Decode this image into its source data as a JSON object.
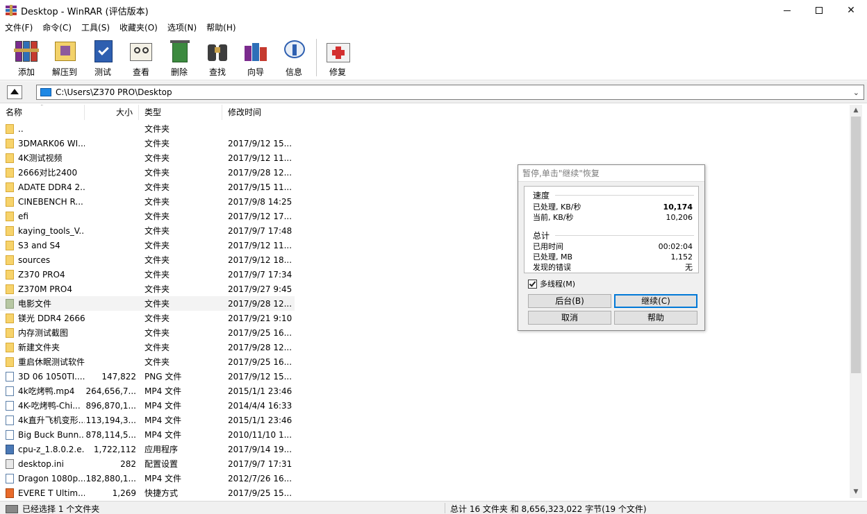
{
  "window": {
    "title": "Desktop - WinRAR (评估版本)",
    "minimize": "—",
    "maximize": "☐",
    "close": "✕"
  },
  "menu": [
    "文件(F)",
    "命令(C)",
    "工具(S)",
    "收藏夹(O)",
    "选项(N)",
    "帮助(H)"
  ],
  "toolbar": {
    "add": "添加",
    "extract": "解压到",
    "test": "测试",
    "view": "查看",
    "delete": "删除",
    "find": "查找",
    "wizard": "向导",
    "info": "信息",
    "repair": "修复"
  },
  "address": {
    "path": "C:\\Users\\Z370 PRO\\Desktop"
  },
  "columns": {
    "name": "名称",
    "size": "大小",
    "type": "类型",
    "modified": "修改时间"
  },
  "files": [
    {
      "name": "..",
      "size": "",
      "type": "文件夹",
      "modified": "",
      "icon": "folder"
    },
    {
      "name": "3DMARK06 WI...",
      "size": "",
      "type": "文件夹",
      "modified": "2017/9/12 15...",
      "icon": "folder"
    },
    {
      "name": "4K测试视频",
      "size": "",
      "type": "文件夹",
      "modified": "2017/9/12 11...",
      "icon": "folder"
    },
    {
      "name": "2666对比2400",
      "size": "",
      "type": "文件夹",
      "modified": "2017/9/28 12...",
      "icon": "folder"
    },
    {
      "name": "ADATE DDR4 2...",
      "size": "",
      "type": "文件夹",
      "modified": "2017/9/15 11...",
      "icon": "folder"
    },
    {
      "name": "CINEBENCH R...",
      "size": "",
      "type": "文件夹",
      "modified": "2017/9/8 14:25",
      "icon": "folder"
    },
    {
      "name": "efi",
      "size": "",
      "type": "文件夹",
      "modified": "2017/9/12 17...",
      "icon": "folder"
    },
    {
      "name": "kaying_tools_V...",
      "size": "",
      "type": "文件夹",
      "modified": "2017/9/7 17:48",
      "icon": "folder"
    },
    {
      "name": "S3 and S4",
      "size": "",
      "type": "文件夹",
      "modified": "2017/9/12 11...",
      "icon": "folder"
    },
    {
      "name": "sources",
      "size": "",
      "type": "文件夹",
      "modified": "2017/9/12 18...",
      "icon": "folder"
    },
    {
      "name": "Z370 PRO4",
      "size": "",
      "type": "文件夹",
      "modified": "2017/9/7 17:34",
      "icon": "folder"
    },
    {
      "name": "Z370M PRO4",
      "size": "",
      "type": "文件夹",
      "modified": "2017/9/27 9:45",
      "icon": "folder"
    },
    {
      "name": "电影文件",
      "size": "",
      "type": "文件夹",
      "modified": "2017/9/28 12...",
      "icon": "folder-g",
      "highlight": true
    },
    {
      "name": "镁光 DDR4 2666",
      "size": "",
      "type": "文件夹",
      "modified": "2017/9/21 9:10",
      "icon": "folder"
    },
    {
      "name": "内存测试截图",
      "size": "",
      "type": "文件夹",
      "modified": "2017/9/25 16...",
      "icon": "folder"
    },
    {
      "name": "新建文件夹",
      "size": "",
      "type": "文件夹",
      "modified": "2017/9/28 12...",
      "icon": "folder"
    },
    {
      "name": "重启休眠测试软件",
      "size": "",
      "type": "文件夹",
      "modified": "2017/9/25 16...",
      "icon": "folder"
    },
    {
      "name": "3D 06  1050TI....",
      "size": "147,822",
      "type": "PNG 文件",
      "modified": "2017/9/12 15...",
      "icon": "file"
    },
    {
      "name": "4k吃烤鸭.mp4",
      "size": "264,656,7...",
      "type": "MP4 文件",
      "modified": "2015/1/1 23:46",
      "icon": "file"
    },
    {
      "name": "4K-吃烤鸭-Chi...",
      "size": "896,870,1...",
      "type": "MP4 文件",
      "modified": "2014/4/4 16:33",
      "icon": "file"
    },
    {
      "name": "4k直升飞机变形...",
      "size": "113,194,3...",
      "type": "MP4 文件",
      "modified": "2015/1/1 23:46",
      "icon": "file"
    },
    {
      "name": "Big Buck Bunn...",
      "size": "878,114,5...",
      "type": "MP4 文件",
      "modified": "2010/11/10 1...",
      "icon": "file"
    },
    {
      "name": "cpu-z_1.8.0.2.e...",
      "size": "1,722,112",
      "type": "应用程序",
      "modified": "2017/9/14 19...",
      "icon": "exe"
    },
    {
      "name": "desktop.ini",
      "size": "282",
      "type": "配置设置",
      "modified": "2017/9/7 17:31",
      "icon": "ini"
    },
    {
      "name": "Dragon 1080p....",
      "size": "182,880,1...",
      "type": "MP4 文件",
      "modified": "2012/7/26 16...",
      "icon": "file"
    },
    {
      "name": "EVERE T Ultim...",
      "size": "1,269",
      "type": "快捷方式",
      "modified": "2017/9/25 15...",
      "icon": "lnk"
    }
  ],
  "status": {
    "left": "已经选择 1 个文件夹",
    "right": "总计 16 文件夹 和 8,656,323,022 字节(19 个文件)"
  },
  "dialog": {
    "title": "暂停,单击\"继续\"恢复",
    "speed_label": "速度",
    "processed_speed_label": "已处理, KB/秒",
    "processed_speed_value": "10,174",
    "current_speed_label": "当前, KB/秒",
    "current_speed_value": "10,206",
    "total_label": "总计",
    "elapsed_label": "已用时间",
    "elapsed_value": "00:02:04",
    "processed_mb_label": "已处理, MB",
    "processed_mb_value": "1,152",
    "errors_label": "发现的错误",
    "errors_value": "无",
    "multithread_label": "多线程(M)",
    "multithread_checked": true,
    "btn_background": "后台(B)",
    "btn_continue": "继续(C)",
    "btn_cancel": "取消",
    "btn_help": "帮助"
  }
}
